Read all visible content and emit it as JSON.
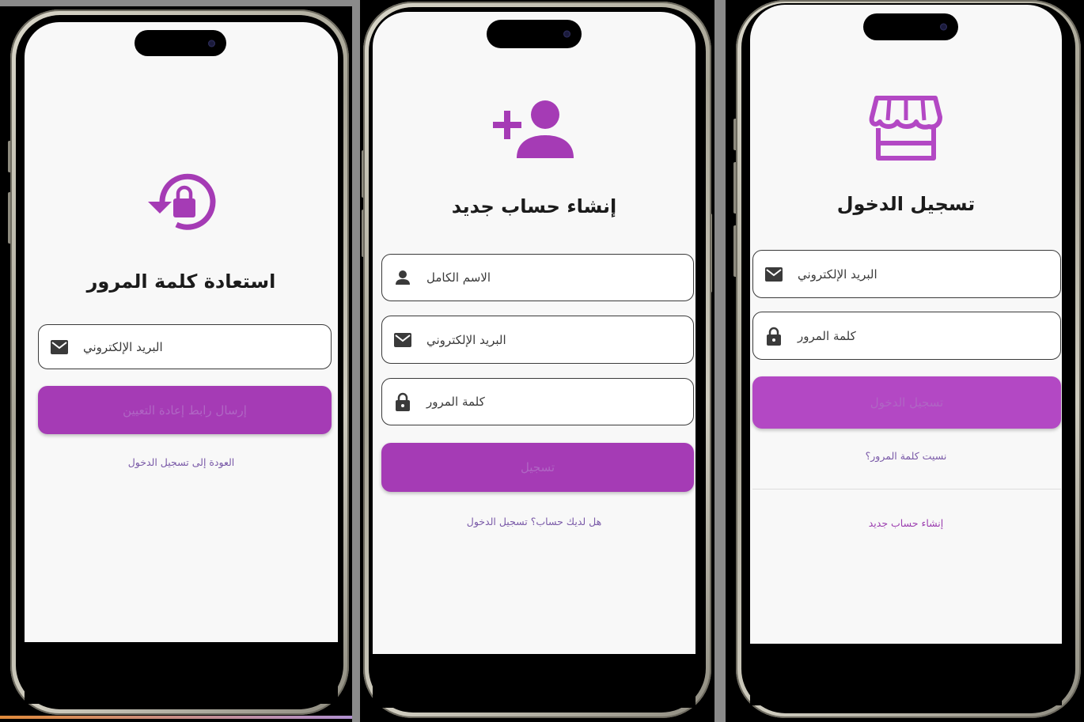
{
  "colors": {
    "accent": "#a53bb5",
    "accent_light": "#b348c4",
    "link": "#7a5aa8",
    "link_pink": "#9c3fb0",
    "text_dark": "#1b1b1b",
    "background": "#f8f8f8"
  },
  "screens": {
    "reset": {
      "icon": "lock-reset-icon",
      "title": "استعادة كلمة المرور",
      "email_field": {
        "icon": "mail-icon",
        "placeholder": "البريد الإلكتروني"
      },
      "submit_label": "إرسال رابط إعادة التعيين",
      "back_link": "العودة إلى تسجيل الدخول"
    },
    "register": {
      "icon": "person-add-icon",
      "title": "إنشاء حساب جديد",
      "name_field": {
        "icon": "person-icon",
        "placeholder": "الاسم الكامل"
      },
      "email_field": {
        "icon": "mail-icon",
        "placeholder": "البريد الإلكتروني"
      },
      "password_field": {
        "icon": "lock-icon",
        "placeholder": "كلمة المرور"
      },
      "submit_label": "تسجيل",
      "login_link": "هل لديك حساب؟ تسجيل الدخول"
    },
    "login": {
      "icon": "storefront-icon",
      "title": "تسجيل الدخول",
      "email_field": {
        "icon": "mail-icon",
        "placeholder": "البريد الإلكتروني"
      },
      "password_field": {
        "icon": "lock-icon",
        "placeholder": "كلمة المرور"
      },
      "submit_label": "تسجيل الدخول",
      "forgot_link": "نسيت كلمة المرور؟",
      "register_link": "إنشاء حساب جديد"
    }
  }
}
